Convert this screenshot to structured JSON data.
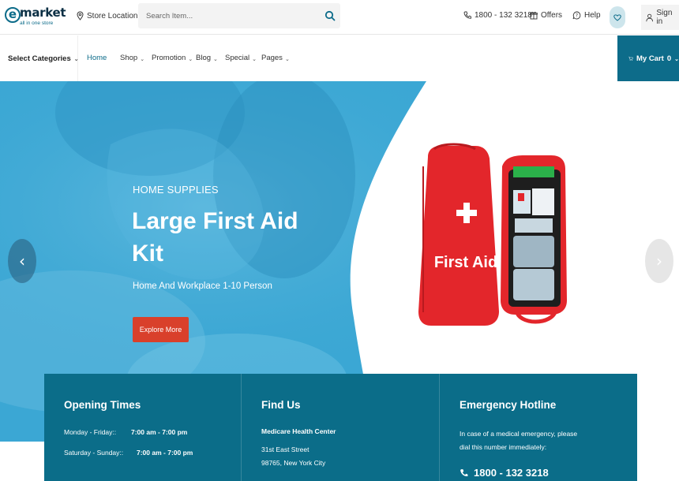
{
  "brand": {
    "name": "market",
    "tagline": "all in one store"
  },
  "header": {
    "store_location": "Store Location",
    "search_placeholder": "Search Item...",
    "phone": "1800 - 132 3218",
    "offers": "Offers",
    "help": "Help",
    "sign_in": "Sign in"
  },
  "nav": {
    "categories_label": "Select Categories",
    "items": [
      {
        "label": "Home"
      },
      {
        "label": "Shop"
      },
      {
        "label": "Promotion"
      },
      {
        "label": "Blog"
      },
      {
        "label": "Special"
      },
      {
        "label": "Pages"
      }
    ],
    "cart_label": "My Cart",
    "cart_count": "0"
  },
  "hero": {
    "subtitle": "HOME SUPPLIES",
    "title": "Large First Aid Kit",
    "description": "Home And Workplace 1-10 Person",
    "button": "Explore More",
    "product_label": "First Aid"
  },
  "info": {
    "opening": {
      "title": "Opening Times",
      "rows": [
        {
          "day": "Monday - Friday::",
          "hours": "7:00 am - 7:00 pm"
        },
        {
          "day": "Saturday - Sunday::",
          "hours": "7:00 am - 7:00 pm"
        }
      ]
    },
    "find_us": {
      "title": "Find Us",
      "name": "Medicare Health Center",
      "address_line1": "31st East Street",
      "address_line2": "98765, New York City"
    },
    "emergency": {
      "title": "Emergency Hotline",
      "text": "In case of a medical emergency, please dial this number immediately:",
      "phone": "1800 - 132 3218"
    }
  },
  "colors": {
    "brand_teal": "#0d6c8a",
    "hero_blue": "#3aa6d3",
    "cta_red": "#d9402b",
    "kit_red": "#e3262b"
  }
}
